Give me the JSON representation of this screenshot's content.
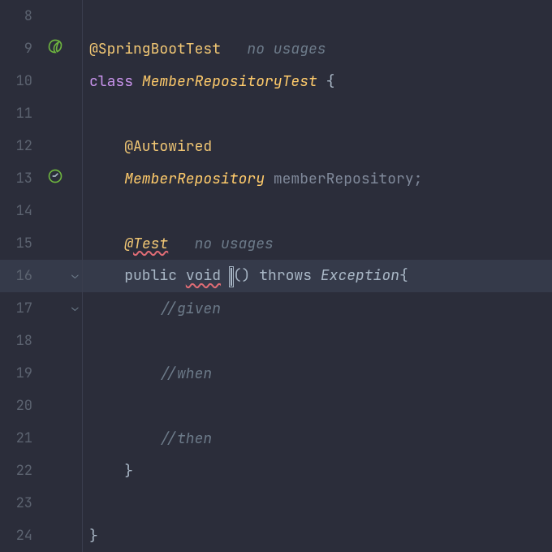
{
  "lines": {
    "8": {
      "num": "8"
    },
    "9": {
      "num": "9",
      "annotation": "@SpringBootTest",
      "hint": "no usages"
    },
    "10": {
      "num": "10",
      "keyword": "class",
      "classname": "MemberRepositoryTest",
      "brace": " {"
    },
    "11": {
      "num": "11"
    },
    "12": {
      "num": "12",
      "annotation": "@Autowired"
    },
    "13": {
      "num": "13",
      "type": "MemberRepository",
      "ident": " memberRepository;"
    },
    "14": {
      "num": "14"
    },
    "15": {
      "num": "15",
      "at": "@",
      "test": "Test",
      "hint": "no usages"
    },
    "16": {
      "num": "16",
      "public": "public ",
      "void": "void",
      "parens": "() ",
      "throws": "throws ",
      "exception": "Exception",
      "brace": "{"
    },
    "17": {
      "num": "17",
      "comment": "//given"
    },
    "18": {
      "num": "18"
    },
    "19": {
      "num": "19",
      "comment": "//when"
    },
    "20": {
      "num": "20"
    },
    "21": {
      "num": "21",
      "comment": "//then"
    },
    "22": {
      "num": "22",
      "brace": "}"
    },
    "23": {
      "num": "23"
    },
    "24": {
      "num": "24",
      "brace": "}"
    }
  },
  "indent1": "    ",
  "indent2": "        "
}
